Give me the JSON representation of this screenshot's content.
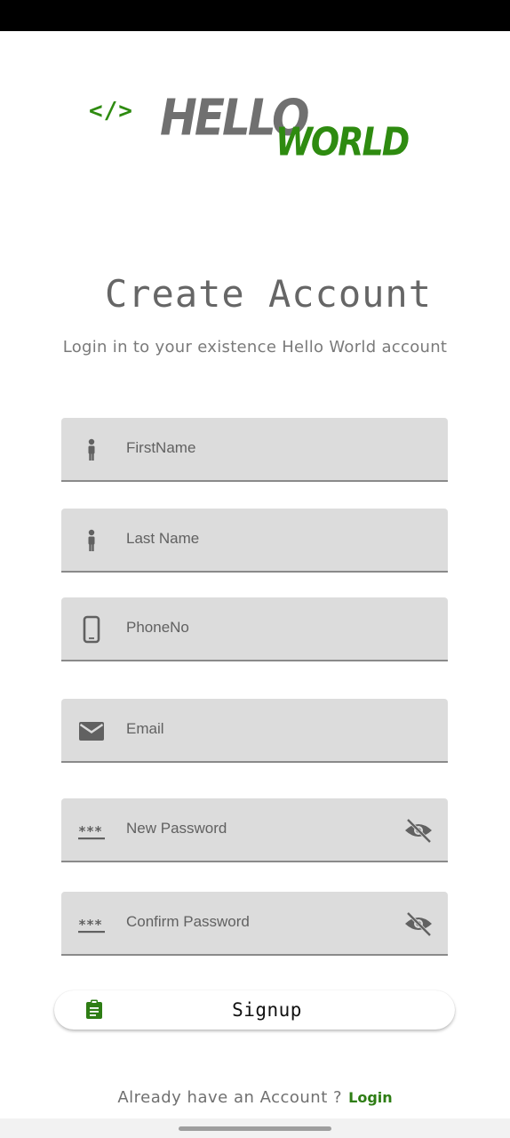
{
  "logo": {
    "code_symbol": "</>",
    "word1": "HELLO",
    "word2": "WORLD"
  },
  "title": "Create Account",
  "subtitle": "Login in to your existence Hello World account",
  "fields": [
    {
      "label": "FirstName",
      "icon": "person-icon"
    },
    {
      "label": "Last Name",
      "icon": "person-icon"
    },
    {
      "label": "PhoneNo",
      "icon": "phone-icon"
    },
    {
      "label": "Email",
      "icon": "mail-icon"
    },
    {
      "label": "New Password",
      "icon": "password-icon",
      "end_icon": "visibility-off-icon"
    },
    {
      "label": "Confirm Password",
      "icon": "password-icon",
      "end_icon": "visibility-off-icon"
    }
  ],
  "signup": {
    "label": "Signup",
    "icon": "clipboard-icon"
  },
  "footer": {
    "text": "Already have an Account ?",
    "link": "Login"
  },
  "colors": {
    "accent": "#2e8b10",
    "logo_gray": "#707070",
    "field_bg": "#dcdcdc",
    "text_gray": "#666666"
  }
}
